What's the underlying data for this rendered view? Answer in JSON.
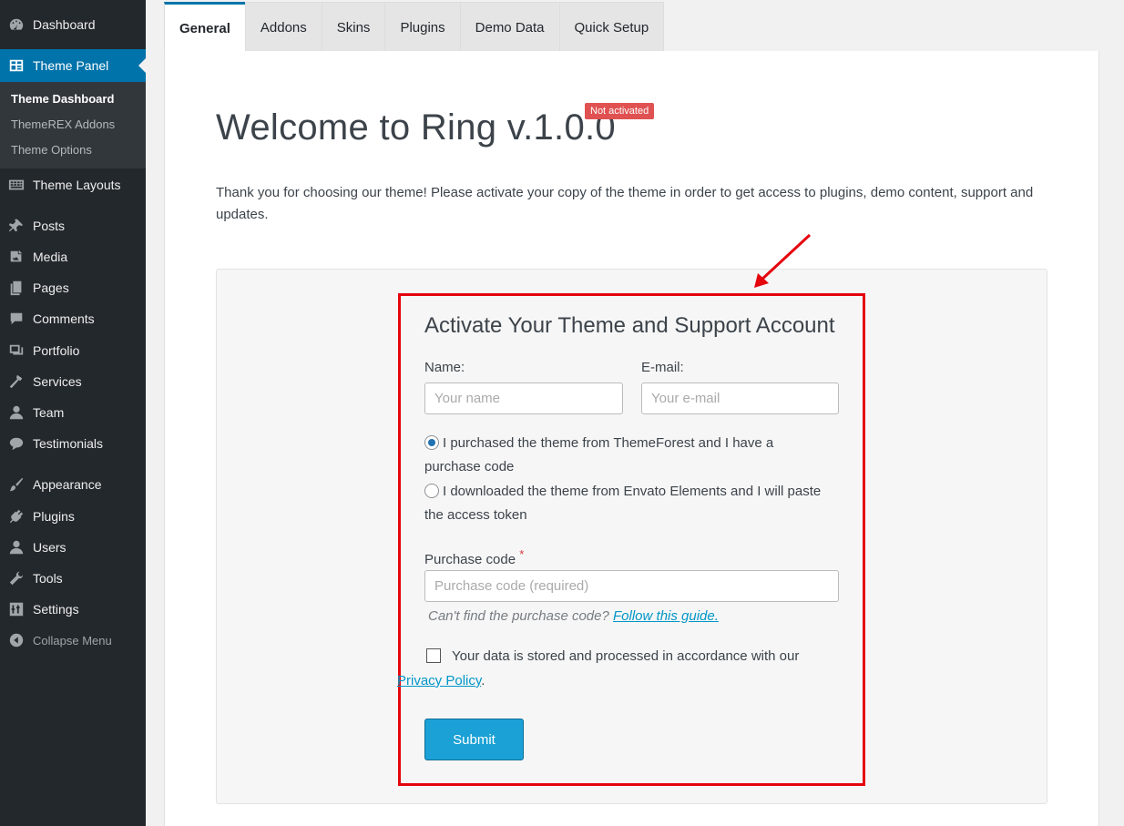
{
  "sidebar": {
    "items": [
      {
        "label": "Dashboard",
        "icon": "dashboard-icon"
      },
      {
        "label": "Theme Panel",
        "icon": "theme-panel-icon"
      },
      {
        "label": "Theme Layouts",
        "icon": "layouts-icon"
      },
      {
        "label": "Posts",
        "icon": "pin-icon"
      },
      {
        "label": "Media",
        "icon": "media-icon"
      },
      {
        "label": "Pages",
        "icon": "pages-icon"
      },
      {
        "label": "Comments",
        "icon": "comments-icon"
      },
      {
        "label": "Portfolio",
        "icon": "portfolio-icon"
      },
      {
        "label": "Services",
        "icon": "hammer-icon"
      },
      {
        "label": "Team",
        "icon": "user-icon"
      },
      {
        "label": "Testimonials",
        "icon": "speech-bubble-icon"
      },
      {
        "label": "Appearance",
        "icon": "brush-icon"
      },
      {
        "label": "Plugins",
        "icon": "plug-icon"
      },
      {
        "label": "Users",
        "icon": "users-icon"
      },
      {
        "label": "Tools",
        "icon": "wrench-icon"
      },
      {
        "label": "Settings",
        "icon": "settings-sliders-icon"
      }
    ],
    "submenu": [
      "Theme Dashboard",
      "ThemeREX Addons",
      "Theme Options"
    ],
    "collapse_label": "Collapse Menu"
  },
  "tabs": [
    "General",
    "Addons",
    "Skins",
    "Plugins",
    "Demo Data",
    "Quick Setup"
  ],
  "main": {
    "title": "Welcome to Ring v.1.0.0",
    "badge": "Not activated",
    "intro": "Thank you for choosing our theme! Please activate your copy of the theme in order to get access to plugins, demo content, support and updates."
  },
  "form": {
    "title": "Activate Your Theme and Support Account",
    "name_label": "Name:",
    "name_placeholder": "Your name",
    "email_label": "E-mail:",
    "email_placeholder": "Your e-mail",
    "radio1": "I purchased the theme from ThemeForest and I have a purchase code",
    "radio2": "I downloaded the theme from Envato Elements and I will paste the access token",
    "purchase_label": "Purchase code",
    "required_mark": "*",
    "purchase_placeholder": "Purchase code (required)",
    "hint_text": "Can't find the purchase code?",
    "hint_link": "Follow this guide.",
    "consent_text": "Your data is stored and processed in accordance with our",
    "privacy_link": "Privacy Policy",
    "consent_end": ".",
    "submit_label": "Submit"
  },
  "colors": {
    "sidebar_bg": "#23282d",
    "current_bg": "#0073aa",
    "badge_bg": "#e05252",
    "submit_bg": "#1ba1d6",
    "highlight": "#e5050d"
  }
}
